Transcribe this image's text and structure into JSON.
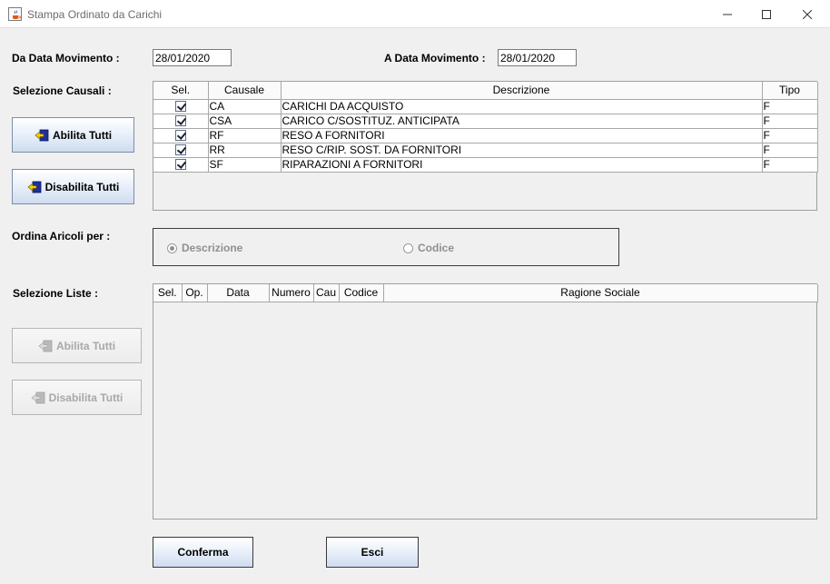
{
  "window": {
    "title": "Stampa Ordinato da Carichi"
  },
  "filters": {
    "da_data_label": "Da Data Movimento :",
    "da_data_value": "28/01/2020",
    "a_data_label": "A  Data Movimento :",
    "a_data_value": "28/01/2020"
  },
  "causali": {
    "label": "Selezione Causali :",
    "columns": [
      "Sel.",
      "Causale",
      "Descrizione",
      "Tipo"
    ],
    "rows": [
      {
        "sel": true,
        "causale": "CA",
        "descrizione": "CARICHI DA ACQUISTO",
        "tipo": "F"
      },
      {
        "sel": true,
        "causale": "CSA",
        "descrizione": "CARICO C/SOSTITUZ. ANTICIPATA",
        "tipo": "F"
      },
      {
        "sel": true,
        "causale": "RF",
        "descrizione": "RESO A FORNITORI",
        "tipo": "F"
      },
      {
        "sel": true,
        "causale": "RR",
        "descrizione": "RESO C/RIP. SOST. DA FORNITORI",
        "tipo": "F"
      },
      {
        "sel": true,
        "causale": "SF",
        "descrizione": "RIPARAZIONI A FORNITORI",
        "tipo": "F"
      }
    ],
    "abilita_label": "Abilita Tutti",
    "disabilita_label": "Disabilita Tutti"
  },
  "ordina": {
    "label": "Ordina Aricoli per :",
    "option_descrizione": "Descrizione",
    "option_codice": "Codice",
    "selected": "Descrizione"
  },
  "liste": {
    "label": "Selezione Liste :",
    "columns": [
      "Sel.",
      "Op.",
      "Data",
      "Numero",
      "Cau",
      "Codice",
      "Ragione Sociale"
    ],
    "abilita_label": "Abilita Tutti",
    "disabilita_label": "Disabilita Tutti"
  },
  "actions": {
    "conferma_label": "Conferma",
    "esci_label": "Esci"
  },
  "colors": {
    "window_bg": "#f0f0f0",
    "button_border": "#7c8ea8",
    "button_icon_yellow": "#f5d200",
    "button_icon_blue": "#1f2f9c"
  },
  "icons": {
    "app": "java-cup-icon",
    "enable_all": "select-all-icon",
    "minimize": "minimize-icon",
    "maximize": "maximize-icon",
    "close": "close-icon"
  }
}
